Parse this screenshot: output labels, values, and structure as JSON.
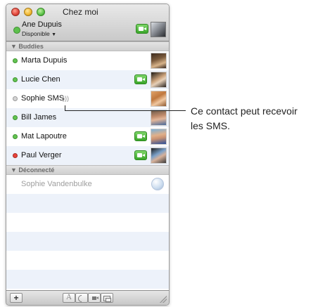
{
  "window": {
    "title": "Chez moi"
  },
  "me": {
    "name": "Ane Dupuis",
    "status": "Disponible",
    "status_color": "#5ec04d"
  },
  "groups": [
    {
      "label": "Buddies",
      "buddies": [
        {
          "name": "Marta Dupuis",
          "status": "available",
          "video": false,
          "sms": false,
          "photo": "photo"
        },
        {
          "name": "Lucie Chen",
          "status": "available",
          "video": true,
          "sms": false,
          "photo": "photo"
        },
        {
          "name": "Sophie SMS",
          "status": "offline",
          "video": false,
          "sms": true,
          "photo": "photo"
        },
        {
          "name": "Bill James",
          "status": "available",
          "video": false,
          "sms": false,
          "photo": "photo"
        },
        {
          "name": "Mat Lapoutre",
          "status": "available",
          "video": true,
          "sms": false,
          "photo": "photo"
        },
        {
          "name": "Paul Verger",
          "status": "busy",
          "video": true,
          "sms": false,
          "photo": "photo"
        }
      ]
    },
    {
      "label": "Déconnecté",
      "buddies": [
        {
          "name": "Sophie Vandenbulke",
          "status": "offline",
          "photo": "globe-icon"
        }
      ]
    }
  ],
  "toolbar": {
    "add_label": "+",
    "text_chat_label": "A"
  },
  "callout": {
    "line1": "Ce contact peut recevoir",
    "line2": "les SMS."
  },
  "colors": {
    "available": "#63c452",
    "busy": "#e8433a",
    "offline": "#d4d4d4",
    "video": "#3aa52a"
  }
}
